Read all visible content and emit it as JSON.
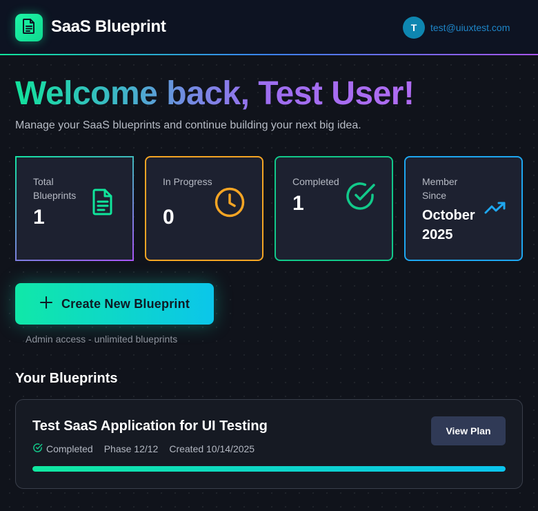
{
  "header": {
    "brand": "SaaS Blueprint",
    "logo_icon": "document-icon",
    "avatar_initial": "T",
    "user_email": "test@uiuxtest.com"
  },
  "welcome": {
    "title": "Welcome back, Test User!",
    "subtitle": "Manage your SaaS blueprints and continue building your next big idea."
  },
  "stats": [
    {
      "label": "Total Blueprints",
      "value": "1",
      "icon": "document-icon",
      "color": "#10e59b"
    },
    {
      "label": "In Progress",
      "value": "0",
      "icon": "clock-icon",
      "color": "#f5a524"
    },
    {
      "label": "Completed",
      "value": "1",
      "icon": "check-circle-icon",
      "color": "#12c98a"
    },
    {
      "label": "Member Since",
      "value": "October 2025",
      "icon": "trending-up-icon",
      "color": "#1ea7f0"
    }
  ],
  "actions": {
    "create_label": "Create New Blueprint",
    "create_icon": "plus-icon",
    "admin_note": "Admin access - unlimited blueprints"
  },
  "blueprints_section": {
    "title": "Your Blueprints",
    "items": [
      {
        "title": "Test SaaS Application for UI Testing",
        "status": "Completed",
        "status_icon": "check-circle-icon",
        "phase": "Phase 12/12",
        "created": "Created 10/14/2025",
        "view_label": "View Plan",
        "progress": 1.0
      }
    ]
  },
  "colors": {
    "accent_green": "#10e59b",
    "accent_cyan": "#0bc6ea",
    "accent_purple": "#a855f7",
    "accent_orange": "#f5a524",
    "accent_blue": "#1ea7f0",
    "background": "#10131b"
  }
}
